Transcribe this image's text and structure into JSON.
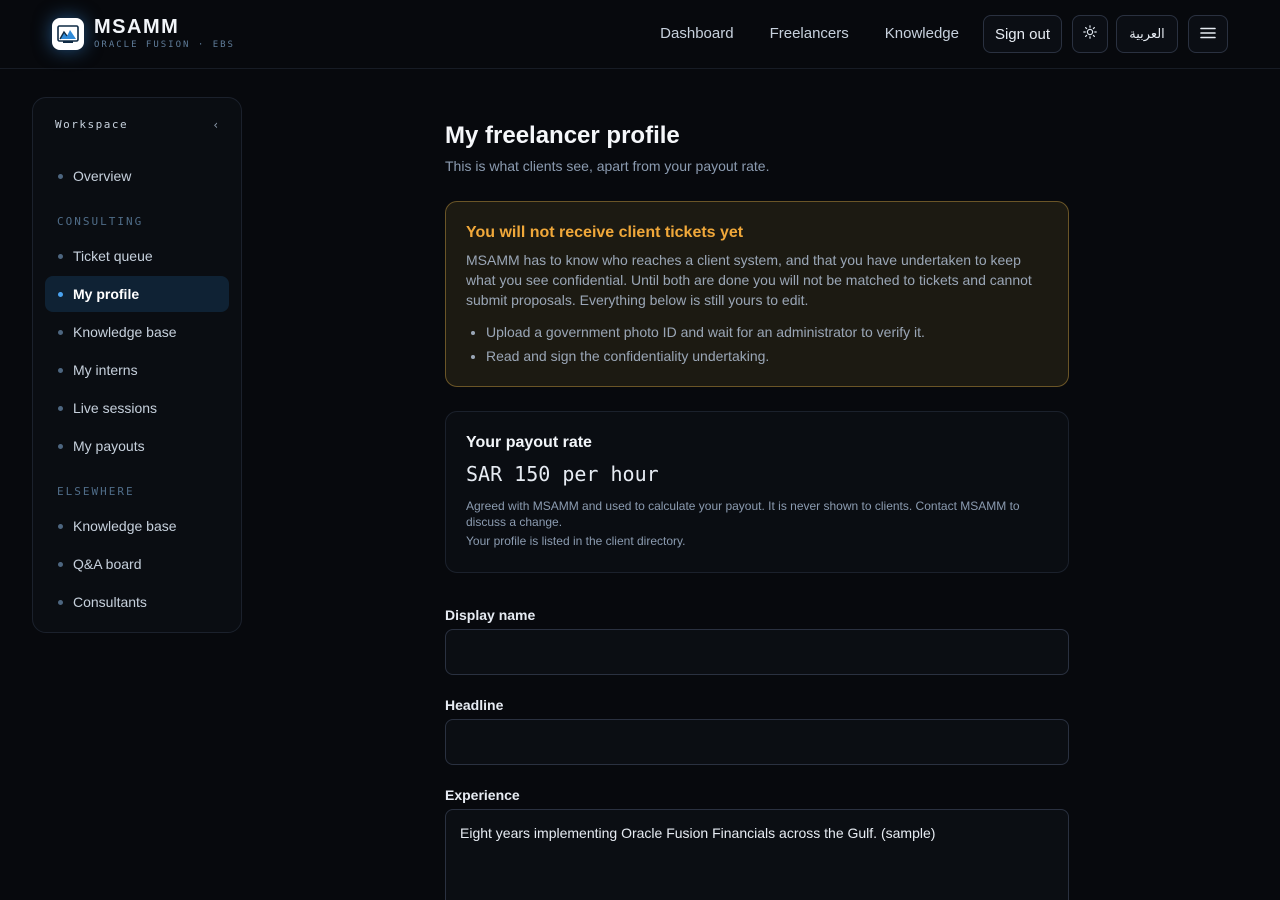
{
  "brand": {
    "name": "MSAMM",
    "tagline": "ORACLE FUSION · EBS"
  },
  "nav": {
    "links": [
      "Dashboard",
      "Freelancers",
      "Knowledge"
    ],
    "sign_out": "Sign out",
    "language": "العربية"
  },
  "icons": {
    "theme_toggle": "sun-icon",
    "menu": "hamburger-menu-icon",
    "collapse": "chevron-left-icon"
  },
  "sidebar": {
    "heading": "Workspace",
    "collapse_glyph": "‹",
    "overview": "Overview",
    "sections": [
      "CONSULTING",
      "ELSEWHERE"
    ],
    "consulting_items": [
      "Ticket queue",
      "My profile",
      "Knowledge base",
      "My interns",
      "Live sessions",
      "My payouts"
    ],
    "elsewhere_items": [
      "Knowledge base",
      "Q&A board",
      "Consultants"
    ],
    "active_item": "My profile"
  },
  "page": {
    "title": "My freelancer profile",
    "subtitle": "This is what clients see, apart from your payout rate."
  },
  "warning": {
    "title": "You will not receive client tickets yet",
    "body": "MSAMM has to know who reaches a client system, and that you have undertaken to keep what you see confidential. Until both are done you will not be matched to tickets and cannot submit proposals. Everything below is still yours to edit.",
    "steps": [
      "Upload a government photo ID and wait for an administrator to verify it.",
      "Read and sign the confidentiality undertaking."
    ]
  },
  "payout": {
    "title": "Your payout rate",
    "rate": "SAR 150 per hour",
    "note": "Agreed with MSAMM and used to calculate your payout. It is never shown to clients. Contact MSAMM to discuss a change.",
    "listing_status": "Your profile is listed in the client directory."
  },
  "form": {
    "display_name_label": "Display name",
    "display_name_value": "",
    "headline_label": "Headline",
    "headline_value": "",
    "experience_label": "Experience",
    "experience_value": "Eight years implementing Oracle Fusion Financials across the Gulf. (sample)"
  },
  "colors": {
    "background": "#07090d",
    "accent": "#4aa3f0",
    "warning": "#f0a83a",
    "active_item_bg": "#0f2234"
  }
}
